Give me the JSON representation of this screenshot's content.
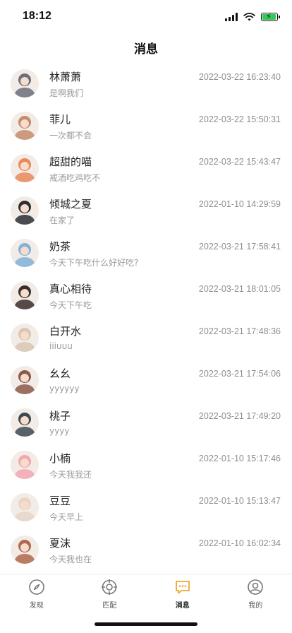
{
  "status_bar": {
    "time": "18:12"
  },
  "header": {
    "title": "消息"
  },
  "messages": [
    {
      "name": "林萧萧",
      "preview": "是啊我们",
      "time": "2022-03-22 16:23:40",
      "avatar_color": "#6a6f7a"
    },
    {
      "name": "菲儿",
      "preview": "一次都不会",
      "time": "2022-03-22 15:50:31",
      "avatar_color": "#c58b6c"
    },
    {
      "name": "超甜的喵",
      "preview": "戒酒吃鸡吃不",
      "time": "2022-03-22 15:43:47",
      "avatar_color": "#e98a5c"
    },
    {
      "name": "倾城之夏",
      "preview": "在家了",
      "time": "2022-01-10 14:29:59",
      "avatar_color": "#2c2f33"
    },
    {
      "name": "奶茶",
      "preview": "今天下午吃什么好好吃?",
      "time": "2022-03-21 17:58:41",
      "avatar_color": "#7fb3d9"
    },
    {
      "name": "真心相待",
      "preview": "今天下午吃",
      "time": "2022-03-21 18:01:05",
      "avatar_color": "#3a2e2a"
    },
    {
      "name": "白开水",
      "preview": "iiiuuu",
      "time": "2022-03-21 17:48:36",
      "avatar_color": "#d9c7b3"
    },
    {
      "name": "幺幺",
      "preview": "yyyyyy",
      "time": "2022-03-21 17:54:06",
      "avatar_color": "#8a5a4a"
    },
    {
      "name": "桃子",
      "preview": "yyyy",
      "time": "2022-03-21 17:49:20",
      "avatar_color": "#3d4a52"
    },
    {
      "name": "小楠",
      "preview": "今天我我还",
      "time": "2022-01-10 15:17:46",
      "avatar_color": "#f2a7b3"
    },
    {
      "name": "豆豆",
      "preview": "今天早上",
      "time": "2022-01-10 15:13:47",
      "avatar_color": "#e6d6c8"
    },
    {
      "name": "夏沫",
      "preview": "今天我也在",
      "time": "2022-01-10 16:02:34",
      "avatar_color": "#b0674e"
    }
  ],
  "tabbar": {
    "tabs": [
      {
        "label": "发现",
        "icon": "compass-icon"
      },
      {
        "label": "匹配",
        "icon": "target-icon"
      },
      {
        "label": "消息",
        "icon": "message-icon",
        "active": true
      },
      {
        "label": "我的",
        "icon": "profile-icon"
      }
    ],
    "active_color": "#f0a830"
  }
}
